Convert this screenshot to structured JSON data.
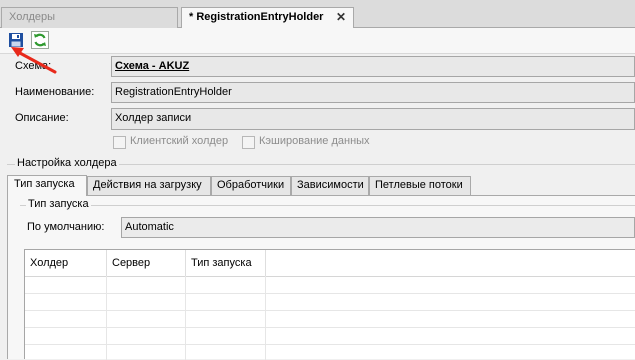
{
  "tabs": [
    {
      "label": "Холдеры",
      "active": false
    },
    {
      "label": "* RegistrationEntryHolder",
      "active": true,
      "close_glyph": "✕"
    }
  ],
  "toolbar": {
    "buttons": [
      {
        "icon": "save-icon",
        "interactable": true
      },
      {
        "icon": "refresh-icon",
        "interactable": true
      }
    ]
  },
  "form": {
    "scheme_label": "Схема:",
    "scheme_value": "Схема - AKUZ",
    "name_label": "Наименование:",
    "name_value": "RegistrationEntryHolder",
    "description_label": "Описание:",
    "description_value": "Холдер записи",
    "client_holder_label": "Клиентский холдер",
    "caching_label": "Кэширование данных"
  },
  "group": {
    "title": "Настройка холдера",
    "tabs": [
      "Тип запуска",
      "Действия на загрузку",
      "Обработчики",
      "Зависимости",
      "Петлевые потоки"
    ],
    "active_tab": 0
  },
  "launch": {
    "section_title": "Тип запуска",
    "default_label": "По умолчанию:",
    "default_value": "Automatic",
    "table_columns": [
      "Холдер",
      "Сервер",
      "Тип запуска"
    ]
  },
  "colors": {
    "annotation_arrow": "#e8291b",
    "save_icon": "#1f4fa0",
    "refresh_icon": "#2f9a2f"
  }
}
